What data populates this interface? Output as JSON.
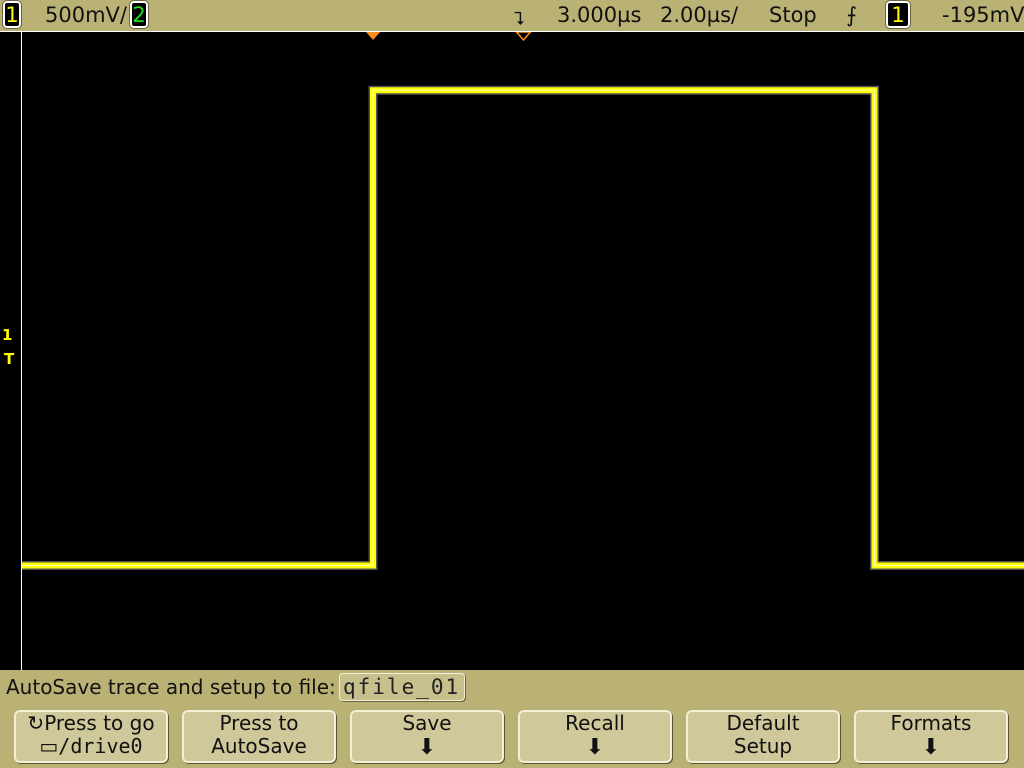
{
  "header": {
    "ch1_label": "1",
    "ch1_scale": "500mV/",
    "ch2_label": "2",
    "delay": "3.000µs",
    "timebase": "2.00µs/",
    "run_state": "Stop",
    "trigger_slope": "rising-edge-icon",
    "trigger_source": "1",
    "trigger_level": "-195mV"
  },
  "colors": {
    "ch1": "#ffff00",
    "ch2": "#22dd22",
    "bezel": "#bab274",
    "marker": "#ff8c1a"
  },
  "chart_data": {
    "type": "line",
    "series": [
      {
        "name": "1",
        "x_us": [
          -7,
          0,
          0,
          10,
          10,
          13
        ],
        "y_v": [
          -1.47,
          -1.47,
          1.51,
          1.51,
          -1.47,
          -1.47
        ]
      }
    ],
    "xlim_us": [
      -7,
      13
    ],
    "ylim_v": [
      -2.125,
      1.875
    ],
    "volts_per_div": 0.5,
    "us_per_div": 2,
    "trigger_level_v": -0.195
  },
  "markers": {
    "ground_label": "1",
    "trigger_label": "T"
  },
  "softkeys": {
    "message": "AutoSave trace and setup to file:",
    "filename": "qfile_01",
    "buttons": [
      {
        "line1": "Press to go",
        "line2": "/drive0"
      },
      {
        "line1": "Press to",
        "line2": "AutoSave"
      },
      {
        "line1": "Save",
        "line2": ""
      },
      {
        "line1": "Recall",
        "line2": ""
      },
      {
        "line1": "Default",
        "line2": "Setup"
      },
      {
        "line1": "Formats",
        "line2": ""
      }
    ]
  }
}
